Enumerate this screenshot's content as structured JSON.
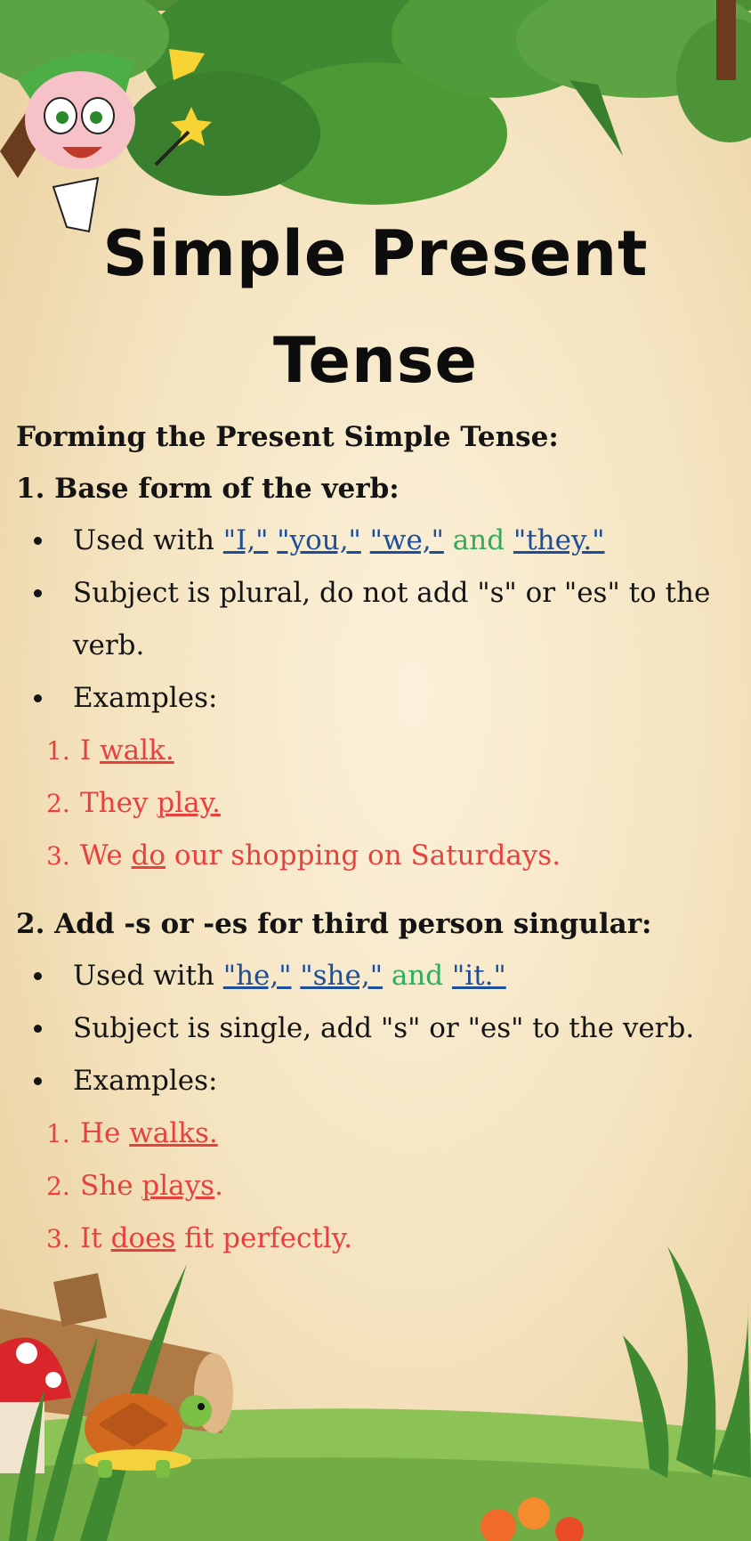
{
  "title": {
    "line1": "Simple Present",
    "line2": "Tense"
  },
  "heading": "Forming the Present Simple Tense:",
  "section1": {
    "heading": "1. Base form of the verb:",
    "used_prefix": "Used with",
    "pronouns": [
      "\"I,\"",
      "\"you,\"",
      "\"we,\""
    ],
    "and_word": "and",
    "last_pronoun": "\"they.\"",
    "rule": "Subject is plural, do not add \"s\" or \"es\" to the",
    "rule_cont": "verb.",
    "examples_label": "Examples:",
    "examples": [
      {
        "num": "1.",
        "pre": "I",
        "verb": "walk.",
        "post": ""
      },
      {
        "num": "2.",
        "pre": "They",
        "verb": "play.",
        "post": ""
      },
      {
        "num": "3.",
        "pre": "We",
        "verb": "do",
        "post": "our shopping on Saturdays."
      }
    ]
  },
  "section2": {
    "heading": "2. Add -s or -es for third person singular:",
    "used_prefix": "Used with",
    "pronouns": [
      "\"he,\"",
      "\"she,\""
    ],
    "and_word": "and",
    "last_pronoun": "\"it.\"",
    "rule": "Subject is single, add \"s\" or \"es\" to the verb.",
    "examples_label": "Examples:",
    "examples": [
      {
        "num": "1.",
        "pre": "He",
        "verb": "walks.",
        "post": ""
      },
      {
        "num": "2.",
        "pre": "She",
        "verb": "plays",
        "post": "."
      },
      {
        "num": "3.",
        "pre": "It",
        "verb": "does",
        "post": "fit perfectly."
      }
    ]
  },
  "colors": {
    "example_text": "#e8413d",
    "pronoun_link": "#1c4e9c",
    "and_word": "#2fae5a",
    "tree_green": "#3f8a31",
    "grass_green": "#7fb84a"
  },
  "icons": [
    "tree-canopy-decoration",
    "fairy-character-illustration",
    "turtle-illustration",
    "mushroom-illustration",
    "log-illustration",
    "grass-decoration",
    "flower-decoration"
  ]
}
